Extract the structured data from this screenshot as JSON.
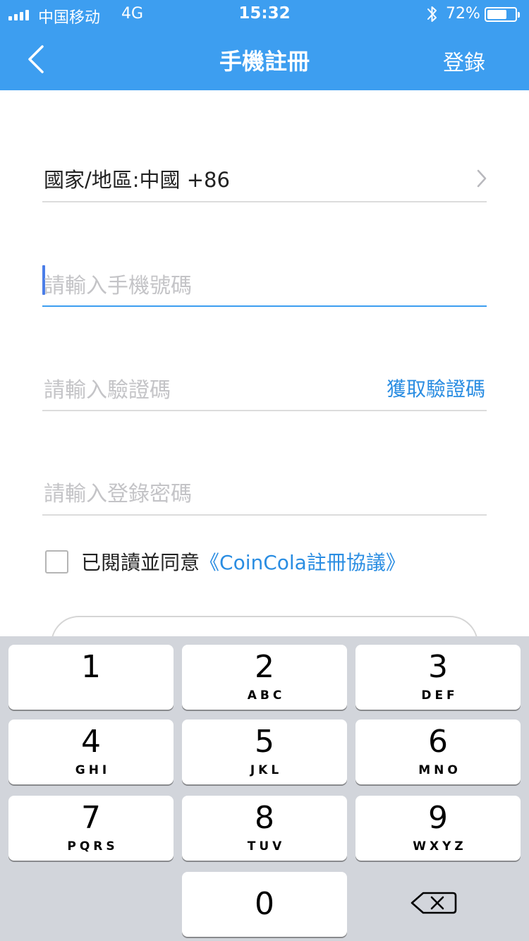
{
  "status_bar": {
    "carrier": "中国移动",
    "network": "4G",
    "time": "15:32",
    "battery": "72%",
    "battery_level": 0.72
  },
  "nav": {
    "title": "手機註冊",
    "right_action": "登錄"
  },
  "form": {
    "country_label": "國家/地區:中國 +86",
    "phone_placeholder": "請輸入手機號碼",
    "code_placeholder": "請輸入驗證碼",
    "get_code_label": "獲取驗證碼",
    "password_placeholder": "請輸入登錄密碼",
    "agree_text": "已閱讀並同意",
    "agree_link": "《CoinCola註冊協議》"
  },
  "keypad": {
    "keys": [
      {
        "num": "1",
        "letters": ""
      },
      {
        "num": "2",
        "letters": "ABC"
      },
      {
        "num": "3",
        "letters": "DEF"
      },
      {
        "num": "4",
        "letters": "GHI"
      },
      {
        "num": "5",
        "letters": "JKL"
      },
      {
        "num": "6",
        "letters": "MNO"
      },
      {
        "num": "7",
        "letters": "PQRS"
      },
      {
        "num": "8",
        "letters": "TUV"
      },
      {
        "num": "9",
        "letters": "WXYZ"
      },
      {
        "num": "0",
        "letters": ""
      }
    ]
  },
  "colors": {
    "accent": "#3d9ef0",
    "link": "#2a8de2",
    "placeholder": "#c4c4c7",
    "keypad_bg": "#d2d5db"
  }
}
